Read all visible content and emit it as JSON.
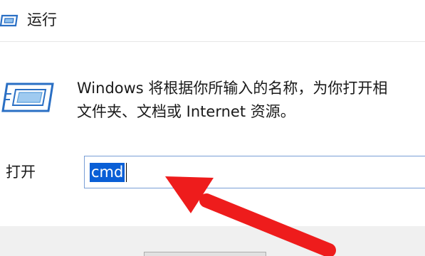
{
  "window": {
    "title": "运行"
  },
  "main": {
    "description_line1": "Windows 将根据你所输入的名称，为你打开相",
    "description_line2": "文件夹、文档或 Internet 资源。"
  },
  "open_field": {
    "label": "打开",
    "value": "cmd"
  },
  "icons": {
    "title_icon": "run-app-icon",
    "main_icon": "run-app-icon",
    "annotation": "red-arrow-annotation"
  },
  "colors": {
    "selection": "#0a5fd6",
    "arrow": "#ee1c1c",
    "footer": "#f0f0f0"
  }
}
